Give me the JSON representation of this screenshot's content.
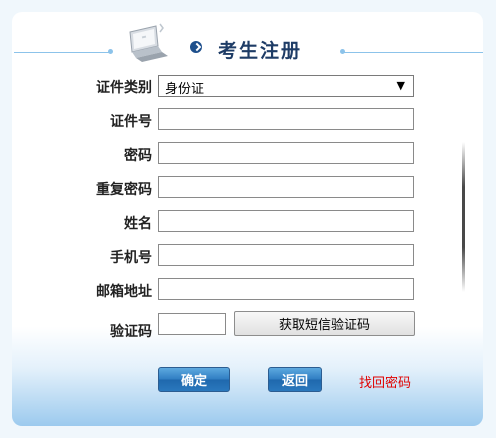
{
  "header": {
    "title": "考生注册",
    "icon": "monitor-icon"
  },
  "form": {
    "id_type": {
      "label": "证件类别",
      "selected": "身份证"
    },
    "id_number": {
      "label": "证件号",
      "value": ""
    },
    "password": {
      "label": "密码",
      "value": ""
    },
    "confirm_password": {
      "label": "重复密码",
      "value": ""
    },
    "name": {
      "label": "姓名",
      "value": ""
    },
    "phone": {
      "label": "手机号",
      "value": ""
    },
    "email": {
      "label": "邮箱地址",
      "value": ""
    },
    "code": {
      "label": "验证码",
      "value": ""
    },
    "sms_button_label": "获取短信验证码"
  },
  "actions": {
    "confirm_label": "确定",
    "back_label": "返回",
    "find_password_label": "找回密码"
  },
  "colors": {
    "title": "#1e3c66",
    "button_blue": "#2f7dc2",
    "link_red": "#e00000"
  }
}
